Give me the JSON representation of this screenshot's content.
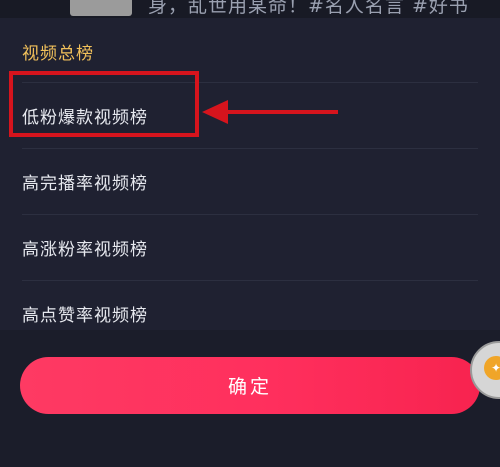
{
  "feed_preview": {
    "caption": "身，乱世用某命！#名人名言 #好书"
  },
  "picker": {
    "section_title": "视频总榜",
    "options": [
      {
        "label": "低粉爆款视频榜",
        "highlighted": true
      },
      {
        "label": "高完播率视频榜",
        "highlighted": false
      },
      {
        "label": "高涨粉率视频榜",
        "highlighted": false
      },
      {
        "label": "高点赞率视频榜",
        "highlighted": false
      }
    ],
    "confirm_label": "确定"
  },
  "colors": {
    "accent_gold": "#f0c05a",
    "confirm_gradient_start": "#fe3a63",
    "confirm_gradient_end": "#f7234f",
    "annotation_red": "#d6141d"
  },
  "floating_button": {
    "icon": "gift-icon"
  }
}
